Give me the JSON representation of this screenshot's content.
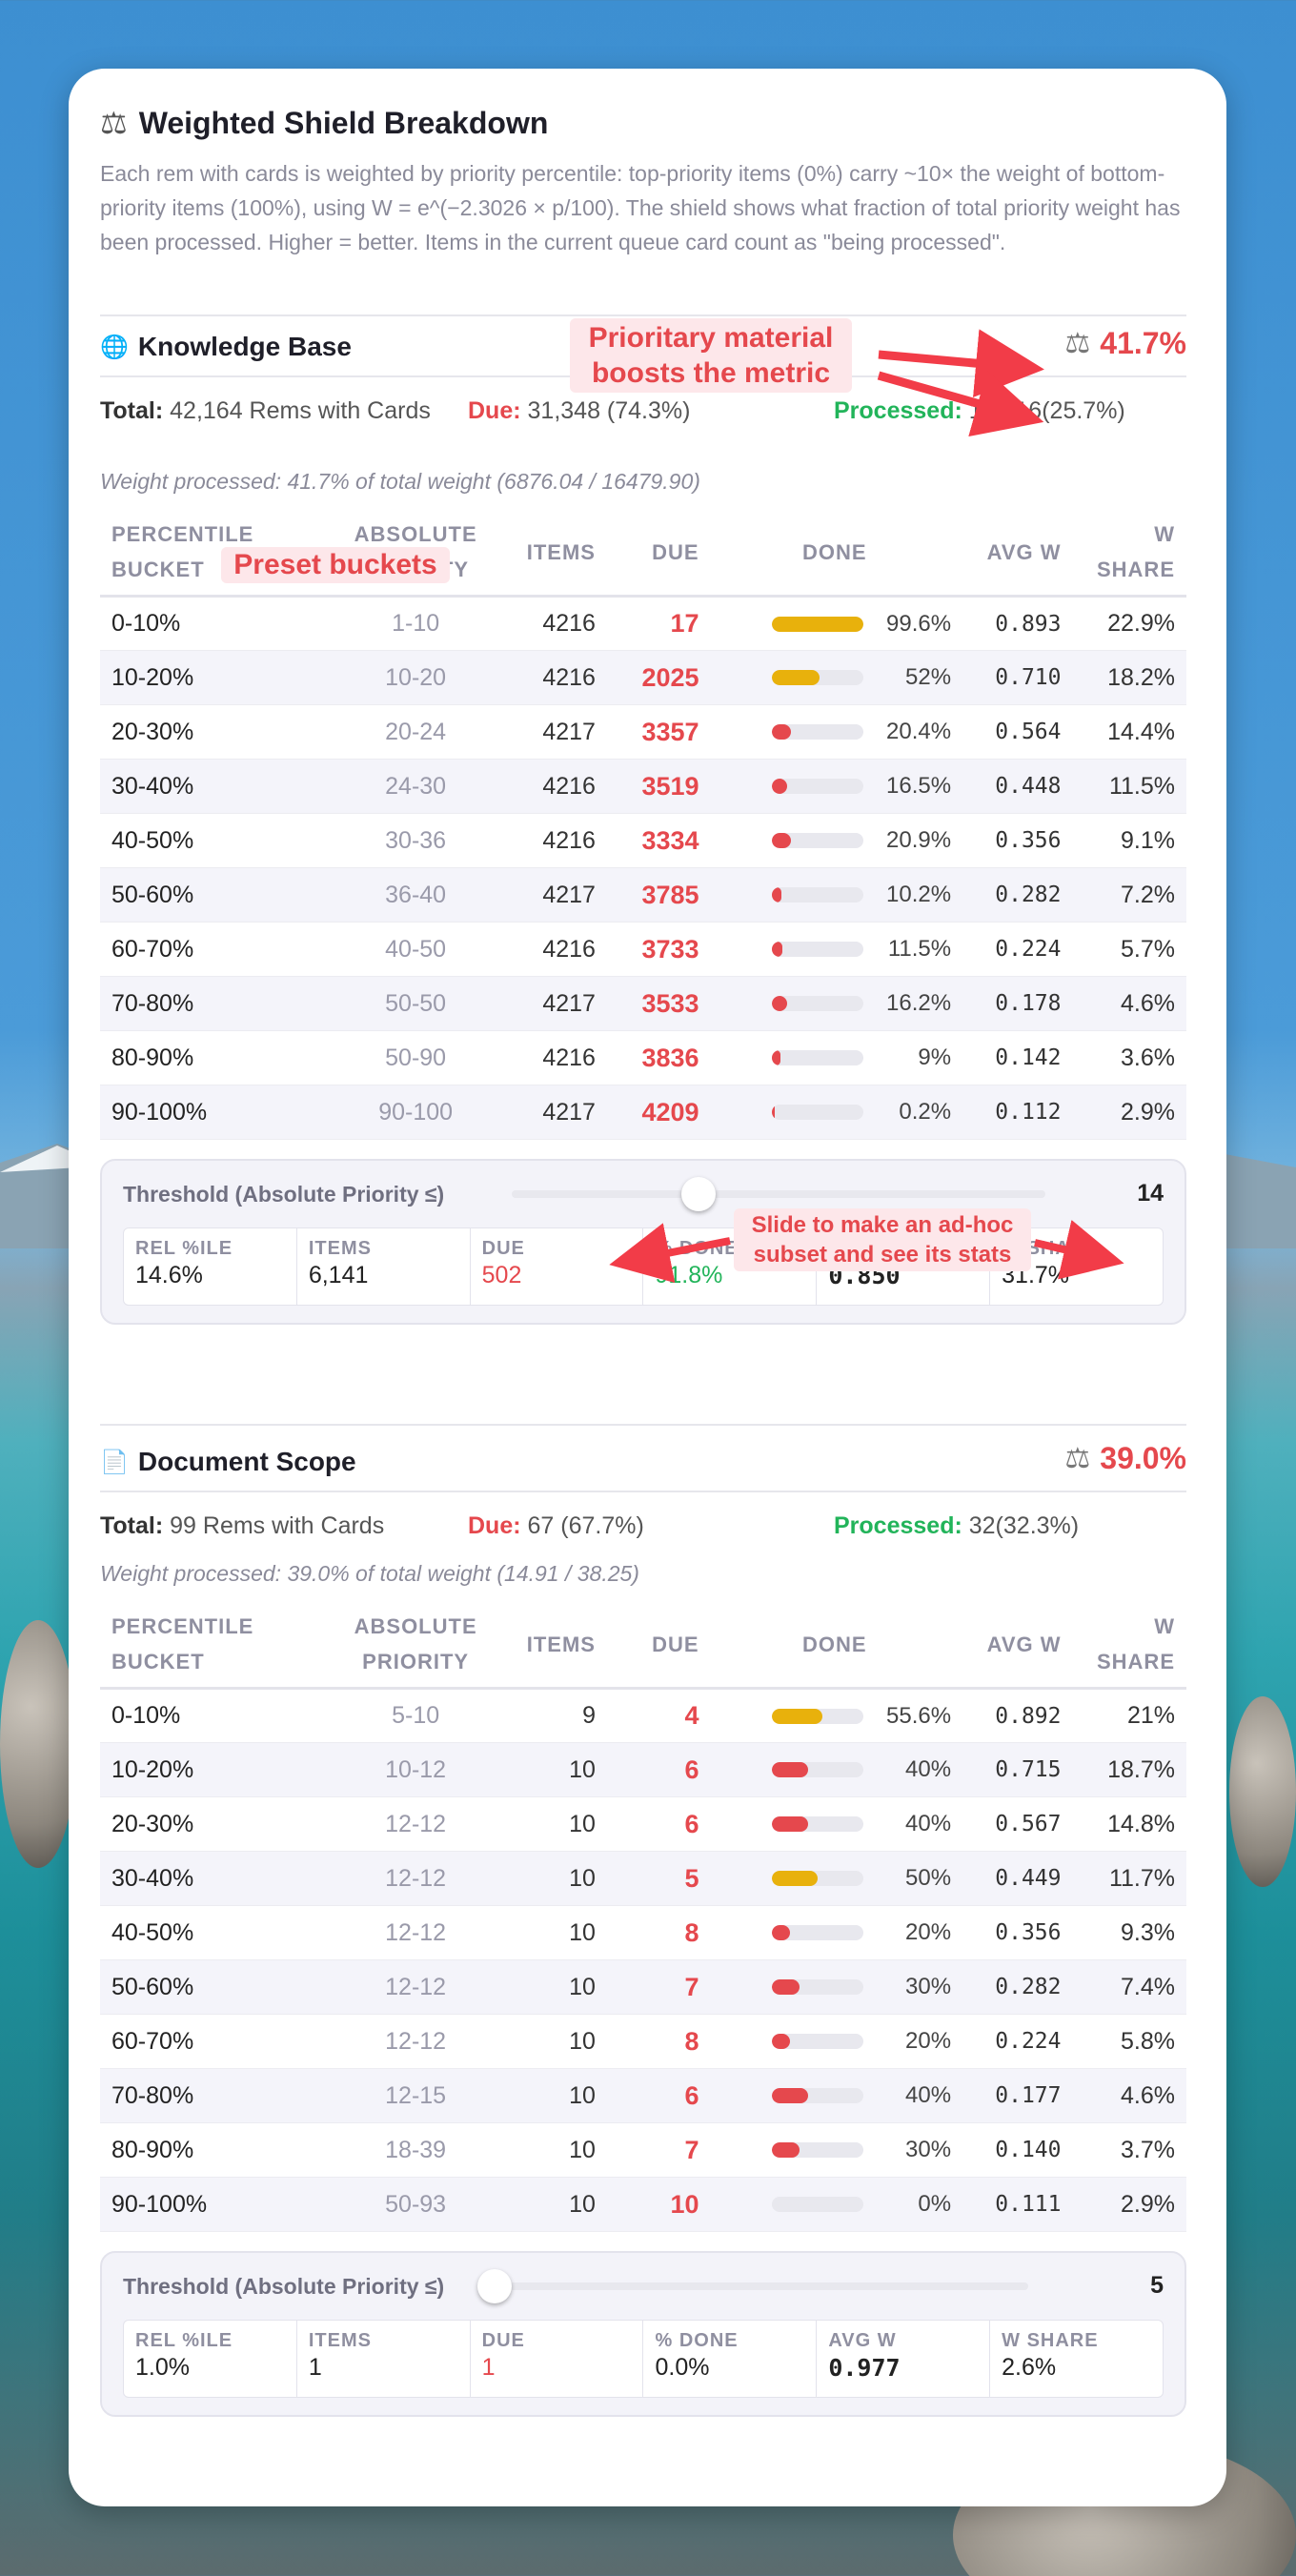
{
  "header": {
    "title": "Weighted Shield Breakdown",
    "icon": "scale-icon",
    "description": "Each rem with cards is weighted by priority percentile: top-priority items (0%) carry ~10× the weight of bottom-priority items (100%), using W = e^(−2.3026 × p/100). The shield shows what fraction of total priority weight has been processed. Higher = better. Items in the current queue card count as \"being processed\"."
  },
  "annotations": {
    "prioritary": "Prioritary material boosts the metric",
    "preset": "Preset buckets",
    "slide": "Slide to make an ad-hoc subset and see its stats"
  },
  "columns": {
    "bucket": "PERCENTILE BUCKET",
    "priority": "ABSOLUTE PRIORITY",
    "items": "ITEMS",
    "due": "DUE",
    "done": "DONE",
    "avgw": "AVG W",
    "wshare": "W SHARE"
  },
  "labels": {
    "total": "Total:",
    "due": "Due:",
    "processed": "Processed:",
    "threshold": "Threshold (Absolute Priority ≤)",
    "rel": "REL %ILE",
    "items": "ITEMS",
    "due_k": "DUE",
    "pct_done": "% DONE",
    "avgw": "AVG W",
    "wshare": "W SHARE"
  },
  "kb": {
    "title": "Knowledge Base",
    "icon": "globe-icon",
    "value": "41.7%",
    "total": "42,164 Rems with Cards",
    "due": "31,348 (74.3%)",
    "processed": "10,816(25.7%)",
    "weight_processed": "Weight processed: 41.7% of total weight  (6876.04 / 16479.90)",
    "rows": [
      {
        "bucket": "0-10%",
        "prio": "1-10",
        "items": "4216",
        "due": "17",
        "done": "99.6%",
        "frac": 0.996,
        "color": "#e8b10c",
        "avgw": "0.893",
        "wshare": "22.9%"
      },
      {
        "bucket": "10-20%",
        "prio": "10-20",
        "items": "4216",
        "due": "2025",
        "done": "52%",
        "frac": 0.52,
        "color": "#e8b10c",
        "avgw": "0.710",
        "wshare": "18.2%"
      },
      {
        "bucket": "20-30%",
        "prio": "20-24",
        "items": "4217",
        "due": "3357",
        "done": "20.4%",
        "frac": 0.204,
        "color": "#e5484d",
        "avgw": "0.564",
        "wshare": "14.4%"
      },
      {
        "bucket": "30-40%",
        "prio": "24-30",
        "items": "4216",
        "due": "3519",
        "done": "16.5%",
        "frac": 0.165,
        "color": "#e5484d",
        "avgw": "0.448",
        "wshare": "11.5%"
      },
      {
        "bucket": "40-50%",
        "prio": "30-36",
        "items": "4216",
        "due": "3334",
        "done": "20.9%",
        "frac": 0.209,
        "color": "#e5484d",
        "avgw": "0.356",
        "wshare": "9.1%"
      },
      {
        "bucket": "50-60%",
        "prio": "36-40",
        "items": "4217",
        "due": "3785",
        "done": "10.2%",
        "frac": 0.102,
        "color": "#e5484d",
        "avgw": "0.282",
        "wshare": "7.2%"
      },
      {
        "bucket": "60-70%",
        "prio": "40-50",
        "items": "4216",
        "due": "3733",
        "done": "11.5%",
        "frac": 0.115,
        "color": "#e5484d",
        "avgw": "0.224",
        "wshare": "5.7%"
      },
      {
        "bucket": "70-80%",
        "prio": "50-50",
        "items": "4217",
        "due": "3533",
        "done": "16.2%",
        "frac": 0.162,
        "color": "#e5484d",
        "avgw": "0.178",
        "wshare": "4.6%"
      },
      {
        "bucket": "80-90%",
        "prio": "50-90",
        "items": "4216",
        "due": "3836",
        "done": "9%",
        "frac": 0.09,
        "color": "#e5484d",
        "avgw": "0.142",
        "wshare": "3.6%"
      },
      {
        "bucket": "90-100%",
        "prio": "90-100",
        "items": "4217",
        "due": "4209",
        "done": "0.2%",
        "frac": 0.002,
        "color": "#e5484d",
        "avgw": "0.112",
        "wshare": "2.9%"
      }
    ],
    "threshold": {
      "value": "14",
      "slider_frac": 0.35,
      "rel": "14.6%",
      "items": "6,141",
      "due": "502",
      "pct_done": "91.8%",
      "avgw": "0.850",
      "wshare": "31.7%"
    }
  },
  "doc": {
    "title": "Document Scope",
    "icon": "document-icon",
    "value": "39.0%",
    "total": "99 Rems with Cards",
    "due": "67 (67.7%)",
    "processed": "32(32.3%)",
    "weight_processed": "Weight processed: 39.0% of total weight  (14.91 / 38.25)",
    "rows": [
      {
        "bucket": "0-10%",
        "prio": "5-10",
        "items": "9",
        "due": "4",
        "done": "55.6%",
        "frac": 0.556,
        "color": "#e8b10c",
        "avgw": "0.892",
        "wshare": "21%"
      },
      {
        "bucket": "10-20%",
        "prio": "10-12",
        "items": "10",
        "due": "6",
        "done": "40%",
        "frac": 0.4,
        "color": "#e5484d",
        "avgw": "0.715",
        "wshare": "18.7%"
      },
      {
        "bucket": "20-30%",
        "prio": "12-12",
        "items": "10",
        "due": "6",
        "done": "40%",
        "frac": 0.4,
        "color": "#e5484d",
        "avgw": "0.567",
        "wshare": "14.8%"
      },
      {
        "bucket": "30-40%",
        "prio": "12-12",
        "items": "10",
        "due": "5",
        "done": "50%",
        "frac": 0.5,
        "color": "#e8b10c",
        "avgw": "0.449",
        "wshare": "11.7%"
      },
      {
        "bucket": "40-50%",
        "prio": "12-12",
        "items": "10",
        "due": "8",
        "done": "20%",
        "frac": 0.2,
        "color": "#e5484d",
        "avgw": "0.356",
        "wshare": "9.3%"
      },
      {
        "bucket": "50-60%",
        "prio": "12-12",
        "items": "10",
        "due": "7",
        "done": "30%",
        "frac": 0.3,
        "color": "#e5484d",
        "avgw": "0.282",
        "wshare": "7.4%"
      },
      {
        "bucket": "60-70%",
        "prio": "12-12",
        "items": "10",
        "due": "8",
        "done": "20%",
        "frac": 0.2,
        "color": "#e5484d",
        "avgw": "0.224",
        "wshare": "5.8%"
      },
      {
        "bucket": "70-80%",
        "prio": "12-15",
        "items": "10",
        "due": "6",
        "done": "40%",
        "frac": 0.4,
        "color": "#e5484d",
        "avgw": "0.177",
        "wshare": "4.6%"
      },
      {
        "bucket": "80-90%",
        "prio": "18-39",
        "items": "10",
        "due": "7",
        "done": "30%",
        "frac": 0.3,
        "color": "#e5484d",
        "avgw": "0.140",
        "wshare": "3.7%"
      },
      {
        "bucket": "90-100%",
        "prio": "50-93",
        "items": "10",
        "due": "10",
        "done": "0%",
        "frac": 0.0,
        "color": "#e5484d",
        "avgw": "0.111",
        "wshare": "2.9%"
      }
    ],
    "threshold": {
      "value": "5",
      "slider_frac": 0.0,
      "rel": "1.0%",
      "items": "1",
      "due": "1",
      "pct_done": "0.0%",
      "avgw": "0.977",
      "wshare": "2.6%"
    }
  }
}
